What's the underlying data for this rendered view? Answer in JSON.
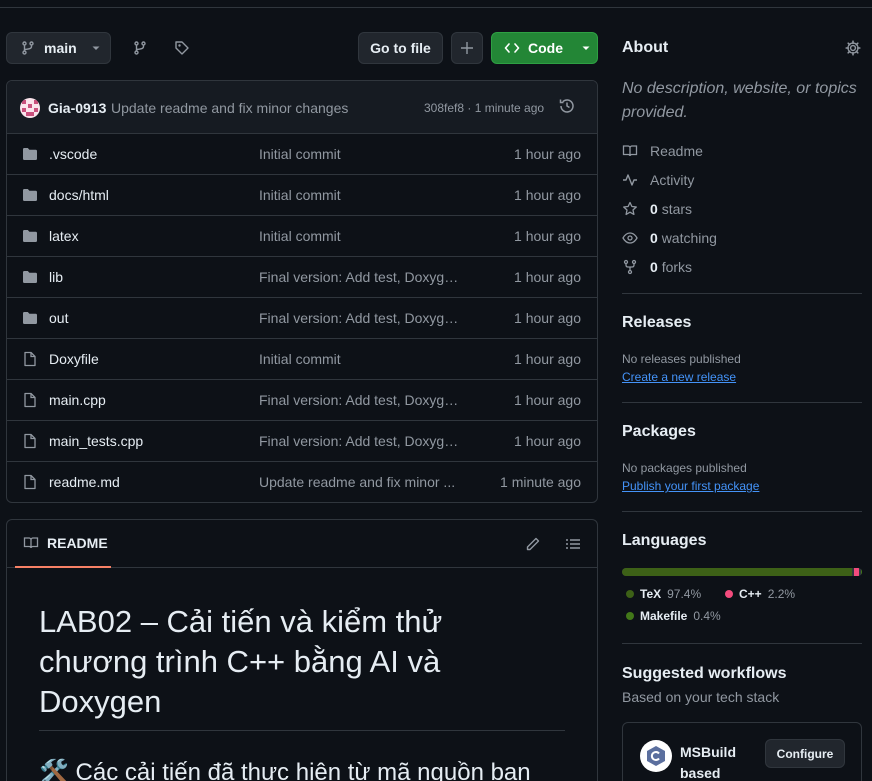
{
  "toolbar": {
    "branch": "main",
    "go_to_file": "Go to file",
    "code": "Code"
  },
  "commit": {
    "author": "Gia-0913",
    "message": "Update readme and fix minor changes",
    "meta": "308fef8 · 1 minute ago"
  },
  "files": [
    {
      "name": ".vscode",
      "type": "folder",
      "message": "Initial commit",
      "age": "1 hour ago"
    },
    {
      "name": "docs/html",
      "type": "folder",
      "message": "Initial commit",
      "age": "1 hour ago"
    },
    {
      "name": "latex",
      "type": "folder",
      "message": "Initial commit",
      "age": "1 hour ago"
    },
    {
      "name": "lib",
      "type": "folder",
      "message": "Final version: Add test, Doxyge...",
      "age": "1 hour ago"
    },
    {
      "name": "out",
      "type": "folder",
      "message": "Final version: Add test, Doxyge...",
      "age": "1 hour ago"
    },
    {
      "name": "Doxyfile",
      "type": "file",
      "message": "Initial commit",
      "age": "1 hour ago"
    },
    {
      "name": "main.cpp",
      "type": "file",
      "message": "Final version: Add test, Doxyge...",
      "age": "1 hour ago"
    },
    {
      "name": "main_tests.cpp",
      "type": "file",
      "message": "Final version: Add test, Doxyge...",
      "age": "1 hour ago"
    },
    {
      "name": "readme.md",
      "type": "file",
      "message": "Update readme and fix minor ...",
      "age": "1 minute ago"
    }
  ],
  "readme": {
    "tab": "README",
    "h1": "LAB02 – Cải tiến và kiểm thử chương trình C++ bằng AI và Doxygen",
    "h2": "🛠️ Các cải tiến đã thực hiện từ mã nguồn ban"
  },
  "about": {
    "title": "About",
    "description": "No description, website, or topics provided.",
    "readme": "Readme",
    "activity": "Activity",
    "stars_count": "0",
    "stars_label": "stars",
    "watching_count": "0",
    "watching_label": "watching",
    "forks_count": "0",
    "forks_label": "forks"
  },
  "releases": {
    "title": "Releases",
    "empty": "No releases published",
    "link": "Create a new release"
  },
  "packages": {
    "title": "Packages",
    "empty": "No packages published",
    "link": "Publish your first package"
  },
  "languages": {
    "title": "Languages",
    "items": [
      {
        "name": "TeX",
        "percent": "97.4%",
        "value": 97.4,
        "color": "#3d6117"
      },
      {
        "name": "C++",
        "percent": "2.2%",
        "value": 2.2,
        "color": "#f34b7d"
      },
      {
        "name": "Makefile",
        "percent": "0.4%",
        "value": 0.4,
        "color": "#427819"
      }
    ]
  },
  "workflows": {
    "title": "Suggested workflows",
    "subtitle": "Based on your tech stack",
    "card_name": "MSBuild based",
    "card_button": "Configure"
  }
}
